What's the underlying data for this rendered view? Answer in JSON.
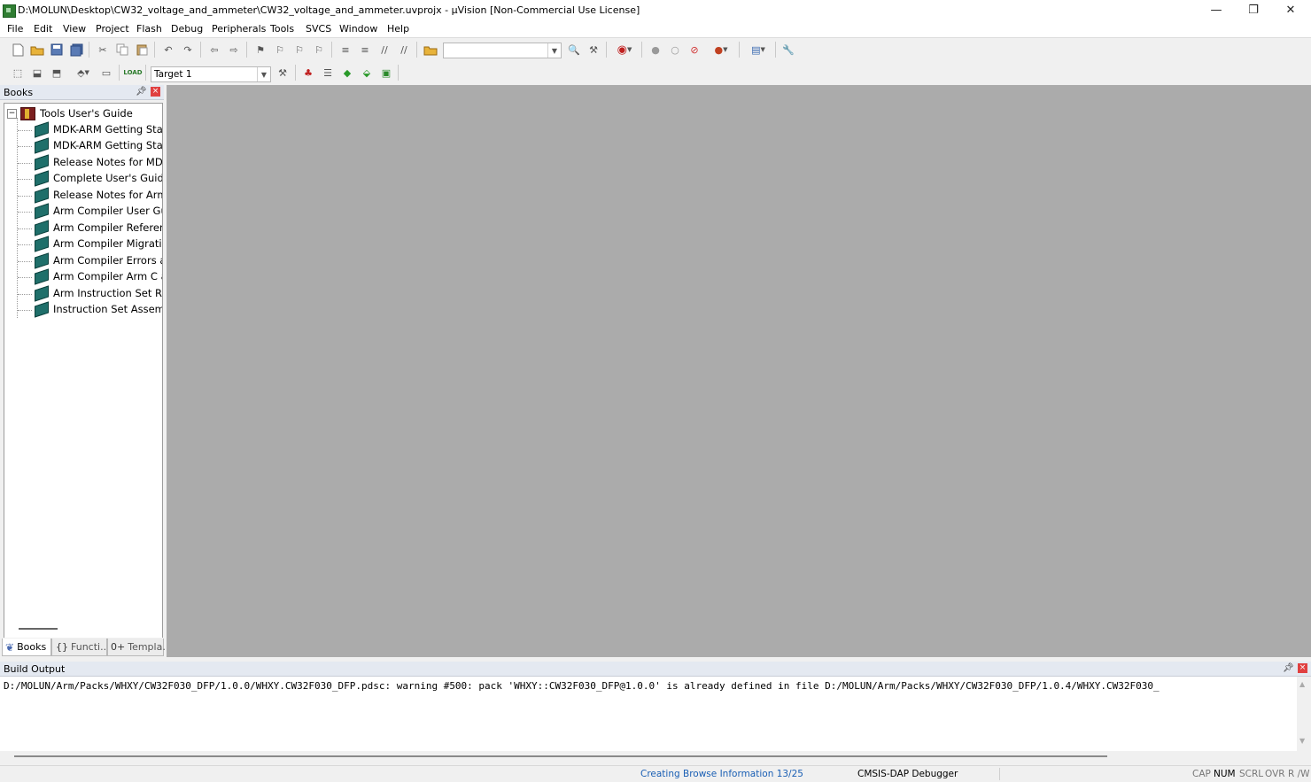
{
  "window": {
    "title": "D:\\MOLUN\\Desktop\\CW32_voltage_and_ammeter\\CW32_voltage_and_ammeter.uvprojx - µVision  [Non-Commercial Use License]",
    "minimize": "—",
    "restore": "❐",
    "close": "✕"
  },
  "menu": [
    "File",
    "Edit",
    "View",
    "Project",
    "Flash",
    "Debug",
    "Peripherals",
    "Tools",
    "SVCS",
    "Window",
    "Help"
  ],
  "toolbar2": {
    "target": "Target 1"
  },
  "books": {
    "header": "Books",
    "root": "Tools User's Guide",
    "expander": "−",
    "items": [
      "MDK-ARM Getting Sta",
      "MDK-ARM Getting Sta",
      "Release Notes for MD",
      "Complete User's Guide",
      "Release Notes for Arm",
      "Arm Compiler User Gu",
      "Arm Compiler Referen",
      "Arm Compiler Migratic",
      "Arm Compiler Errors a",
      "Arm Compiler Arm C a",
      "Arm Instruction Set Re",
      "Instruction Set Assemb"
    ],
    "tabs": [
      "Books",
      "Functi...",
      "Templa..."
    ]
  },
  "build_output": {
    "header": "Build Output",
    "text": "D:/MOLUN/Arm/Packs/WHXY/CW32F030_DFP/1.0.0/WHXY.CW32F030_DFP.pdsc: warning #500: pack 'WHXY::CW32F030_DFP@1.0.0' is already defined in file D:/MOLUN/Arm/Packs/WHXY/CW32F030_DFP/1.0.4/WHXY.CW32F030_"
  },
  "status": {
    "progress": "Creating Browse Information 13/25",
    "debugger": "CMSIS-DAP Debugger",
    "cap": "CAP",
    "num": "NUM",
    "scrl": "SCRL",
    "ovr": "OVR",
    "rw": "R /W"
  },
  "colors": {
    "workspace": "#ababab",
    "status_progress": "#1a5fb4"
  }
}
